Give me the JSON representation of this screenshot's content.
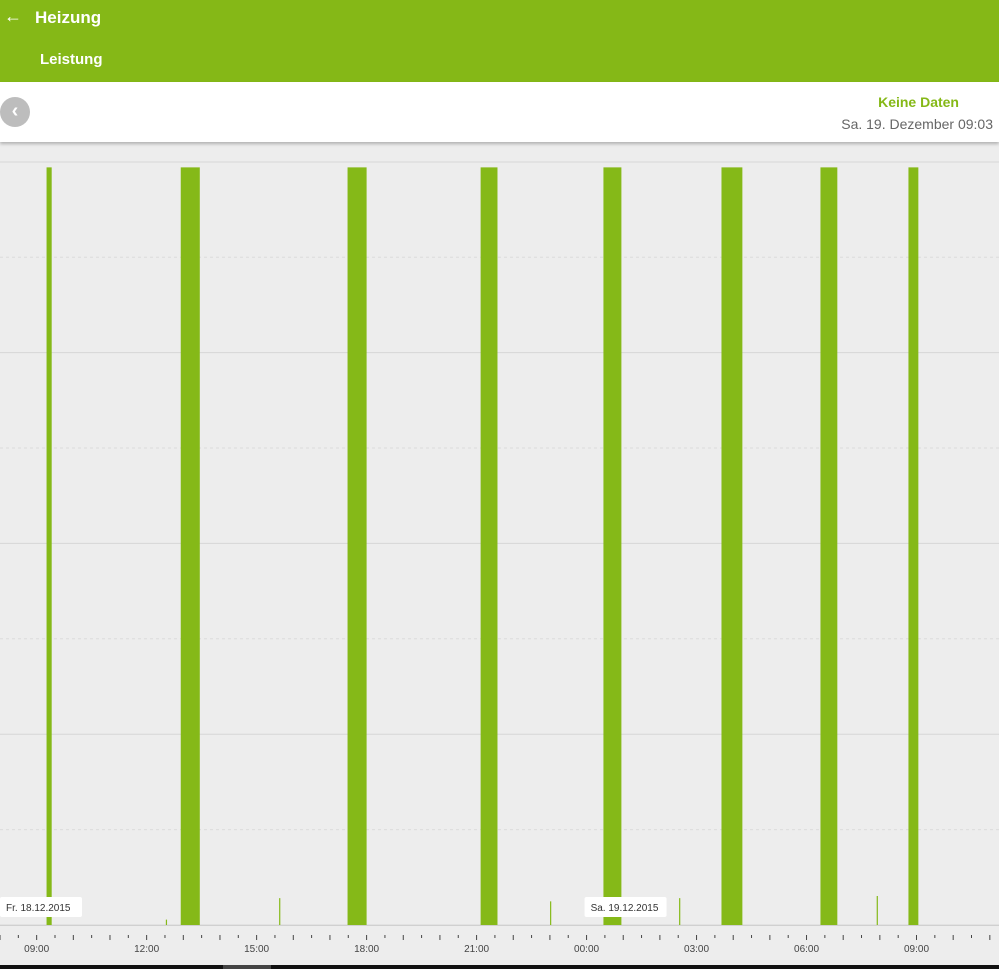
{
  "header": {
    "back_icon": "arrow-left-icon",
    "title": "Heizung",
    "subtitle": "Leistung"
  },
  "info": {
    "prev_icon": "chevron-left-icon",
    "status": "Keine Daten",
    "date": "Sa. 19. Dezember 09:03"
  },
  "colors": {
    "accent": "#85b817",
    "bar": "#85b918"
  },
  "chart_data": {
    "type": "area",
    "title": "Leistung",
    "xlabel": "",
    "ylabel": "",
    "x_unit": "hours since Fr. 18.12.2015 00:00",
    "xlim": [
      8.0,
      35.25
    ],
    "ylim": [
      0,
      7.1
    ],
    "grid": true,
    "tick_labels": [
      {
        "x": 9,
        "label": "09:00"
      },
      {
        "x": 12,
        "label": "12:00"
      },
      {
        "x": 15,
        "label": "15:00"
      },
      {
        "x": 18,
        "label": "18:00"
      },
      {
        "x": 21,
        "label": "21:00"
      },
      {
        "x": 24,
        "label": "00:00"
      },
      {
        "x": 27,
        "label": "03:00"
      },
      {
        "x": 30,
        "label": "06:00"
      },
      {
        "x": 33,
        "label": "09:00"
      }
    ],
    "day_labels": [
      {
        "x": 8.0,
        "label": "Fr. 18.12.2015"
      },
      {
        "x": 24.0,
        "label": "Sa. 19.12.2015"
      }
    ],
    "pulses": [
      {
        "start": 9.27,
        "end": 9.41,
        "value": 7.05
      },
      {
        "start": 12.93,
        "end": 13.45,
        "value": 7.05
      },
      {
        "start": 17.48,
        "end": 18.0,
        "value": 7.05
      },
      {
        "start": 21.11,
        "end": 21.57,
        "value": 7.05
      },
      {
        "start": 24.46,
        "end": 24.95,
        "value": 7.05
      },
      {
        "start": 27.68,
        "end": 28.25,
        "value": 7.05
      },
      {
        "start": 30.38,
        "end": 30.84,
        "value": 7.05
      },
      {
        "start": 32.78,
        "end": 33.05,
        "value": 7.05
      }
    ],
    "spikes": [
      {
        "x": 12.54,
        "value": 0.05
      },
      {
        "x": 15.63,
        "value": 0.25
      },
      {
        "x": 23.02,
        "value": 0.22
      },
      {
        "x": 26.54,
        "value": 0.25
      },
      {
        "x": 31.93,
        "value": 0.27
      }
    ]
  }
}
